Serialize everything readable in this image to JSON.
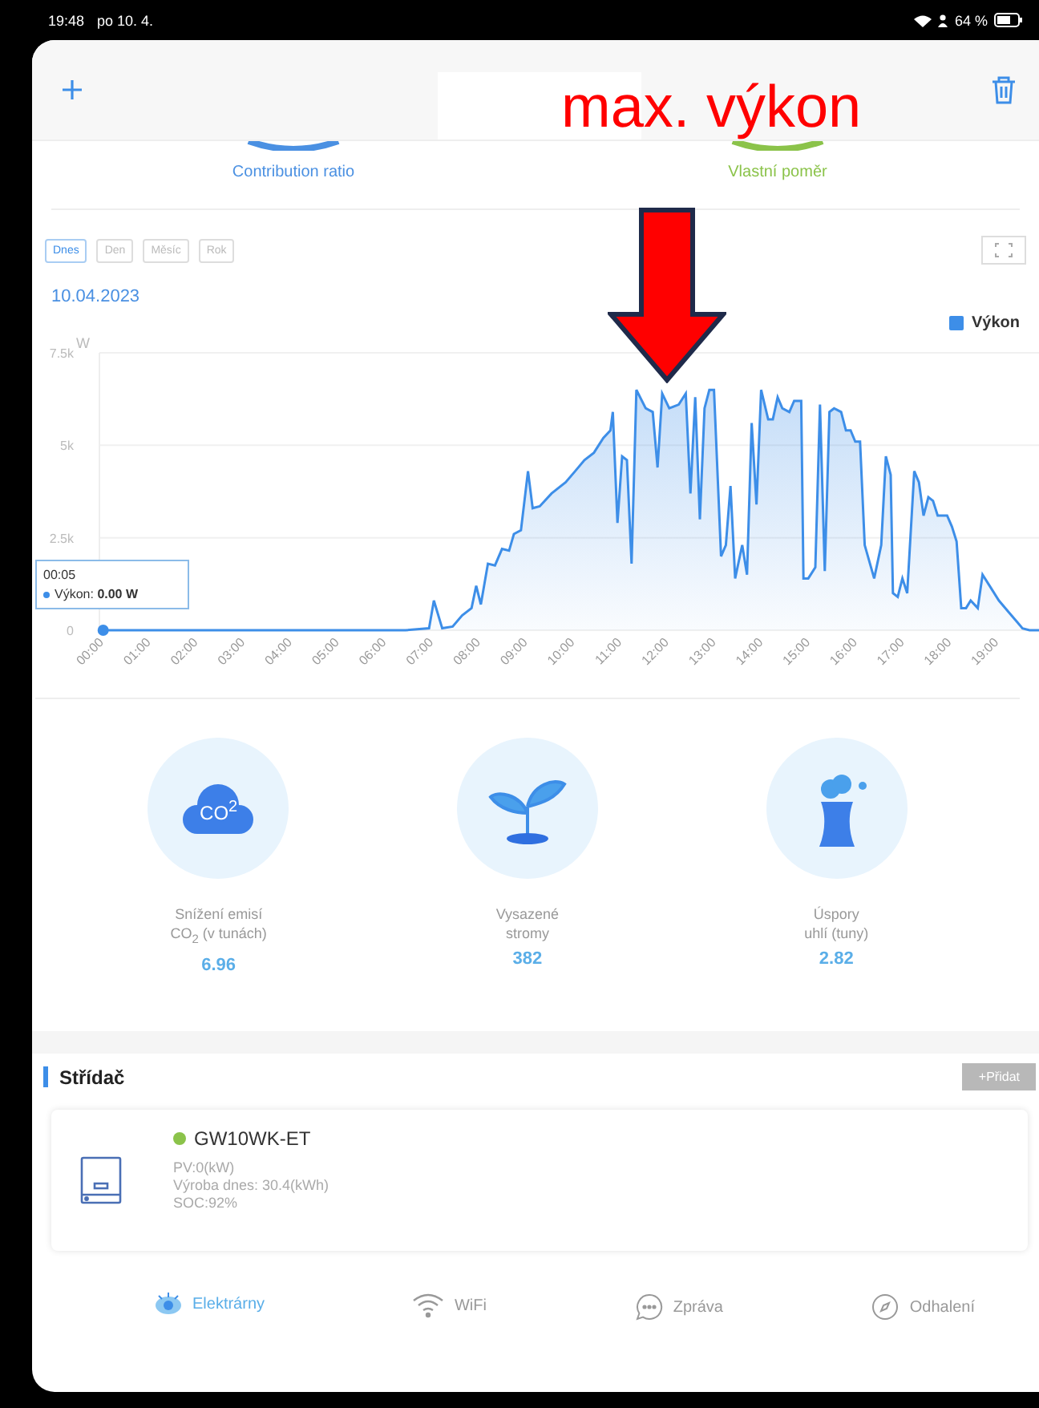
{
  "status_bar": {
    "time": "19:48",
    "date": "po 10. 4.",
    "battery": "64 %"
  },
  "annotation": {
    "text": "max. výkon"
  },
  "ratios": [
    {
      "label": "Contribution ratio",
      "color": "#4a90e2"
    },
    {
      "label": "Vlastní poměr",
      "color": "#8bc34a"
    }
  ],
  "periods": [
    {
      "label": "Dnes",
      "selected": true
    },
    {
      "label": "Den",
      "selected": false
    },
    {
      "label": "Měsíc",
      "selected": false
    },
    {
      "label": "Rok",
      "selected": false
    }
  ],
  "date": "10.04.2023",
  "tooltip": {
    "time": "00:05",
    "text": "Výkon: **0.00 W**"
  },
  "chart_data": {
    "type": "area",
    "ylabel": "W",
    "ylim": [
      0,
      7500
    ],
    "yticks": [
      {
        "value": 0,
        "label": "0"
      },
      {
        "value": 2500,
        "label": "2.5k"
      },
      {
        "value": 5000,
        "label": "5k"
      },
      {
        "value": 7500,
        "label": "7.5k"
      }
    ],
    "xlim": [
      0,
      19.95
    ],
    "xticks": [
      {
        "value": 0,
        "label": "00:00"
      },
      {
        "value": 1,
        "label": "01:00"
      },
      {
        "value": 2,
        "label": "02:00"
      },
      {
        "value": 3,
        "label": "03:00"
      },
      {
        "value": 4,
        "label": "04:00"
      },
      {
        "value": 5,
        "label": "05:00"
      },
      {
        "value": 6,
        "label": "06:00"
      },
      {
        "value": 7,
        "label": "07:00"
      },
      {
        "value": 8,
        "label": "08:00"
      },
      {
        "value": 9,
        "label": "09:00"
      },
      {
        "value": 10,
        "label": "10:00"
      },
      {
        "value": 11,
        "label": "11:00"
      },
      {
        "value": 12,
        "label": "12:00"
      },
      {
        "value": 13,
        "label": "13:00"
      },
      {
        "value": 14,
        "label": "14:00"
      },
      {
        "value": 15,
        "label": "15:00"
      },
      {
        "value": 16,
        "label": "16:00"
      },
      {
        "value": 17,
        "label": "17:00"
      },
      {
        "value": 18,
        "label": "18:00"
      },
      {
        "value": 19,
        "label": "19:00"
      }
    ],
    "x": [
      0.08,
      6.5,
      7.0,
      7.1,
      7.28,
      7.5,
      7.7,
      7.9,
      8.0,
      8.1,
      8.25,
      8.4,
      8.55,
      8.7,
      8.8,
      8.95,
      9.1,
      9.2,
      9.35,
      9.6,
      9.9,
      10.1,
      10.3,
      10.5,
      10.7,
      10.85,
      10.9,
      11.0,
      11.1,
      11.2,
      11.3,
      11.4,
      11.6,
      11.75,
      11.85,
      11.95,
      12.1,
      12.3,
      12.45,
      12.55,
      12.65,
      12.75,
      12.85,
      12.95,
      13.05,
      13.2,
      13.3,
      13.4,
      13.5,
      13.65,
      13.75,
      13.85,
      13.95,
      14.05,
      14.2,
      14.3,
      14.4,
      14.5,
      14.65,
      14.75,
      14.9,
      14.95,
      15.05,
      15.2,
      15.3,
      15.4,
      15.5,
      15.6,
      15.75,
      15.85,
      15.95,
      16.05,
      16.15,
      16.25,
      16.45,
      16.6,
      16.7,
      16.8,
      16.85,
      16.95,
      17.05,
      17.15,
      17.3,
      17.4,
      17.5,
      17.6,
      17.7,
      17.8,
      18.0,
      18.1,
      18.2,
      18.3,
      18.4,
      18.5,
      18.65,
      18.75,
      18.9,
      19.1,
      19.3,
      19.5,
      19.6,
      19.75,
      19.95
    ],
    "series": [
      {
        "name": "Výkon",
        "color": "#3d8ee8",
        "values": [
          0,
          0,
          50,
          800,
          50,
          100,
          400,
          600,
          1200,
          700,
          1800,
          1750,
          2200,
          2150,
          2600,
          2700,
          4300,
          3300,
          3350,
          3700,
          4000,
          4300,
          4600,
          4800,
          5200,
          5400,
          5900,
          2900,
          4700,
          4600,
          1800,
          6500,
          6000,
          5900,
          4400,
          6400,
          6000,
          6100,
          6400,
          3700,
          6300,
          3000,
          6000,
          6500,
          6500,
          2000,
          2300,
          3900,
          1400,
          2300,
          1500,
          5600,
          3400,
          6500,
          5700,
          5700,
          6300,
          6000,
          5900,
          6200,
          6200,
          1400,
          1400,
          1700,
          6100,
          1600,
          5900,
          6000,
          5900,
          5400,
          5400,
          5100,
          5100,
          2300,
          1400,
          2300,
          4700,
          4200,
          1000,
          900,
          1400,
          1000,
          4300,
          4000,
          3100,
          3600,
          3500,
          3100,
          3100,
          2800,
          2400,
          600,
          600,
          800,
          600,
          1500,
          1200,
          800,
          500,
          200,
          50,
          0,
          0
        ]
      }
    ]
  },
  "stats": [
    {
      "kind": "cloud",
      "badge": "CO$^{2}$",
      "lines": [
        "Snížení emisí",
        "CO$_{2}$ (v tunách)"
      ],
      "value": "6.96"
    },
    {
      "kind": "plant",
      "lines": [
        "Vysazené",
        "stromy"
      ],
      "value": "382"
    },
    {
      "kind": "factory",
      "lines": [
        "Úspory",
        "uhlí (tuny)"
      ],
      "value": "2.82"
    }
  ],
  "inverter_section": {
    "title": "Střídač",
    "add_button": "+Přidat"
  },
  "inverter": {
    "name": "GW10WK-ET",
    "color": "#8bc34a",
    "lines": [
      "PV:0(kW)",
      "Výroba dnes: 30.4(kWh)",
      "SOC:92%"
    ]
  },
  "tabs": [
    {
      "kind": "plants",
      "label": "Elektrárny",
      "selected": true
    },
    {
      "kind": "wifi",
      "label": "WiFi",
      "selected": false
    },
    {
      "kind": "message",
      "label": "Zpráva",
      "selected": false
    },
    {
      "kind": "discover",
      "label": "Odhalení",
      "selected": false
    }
  ]
}
